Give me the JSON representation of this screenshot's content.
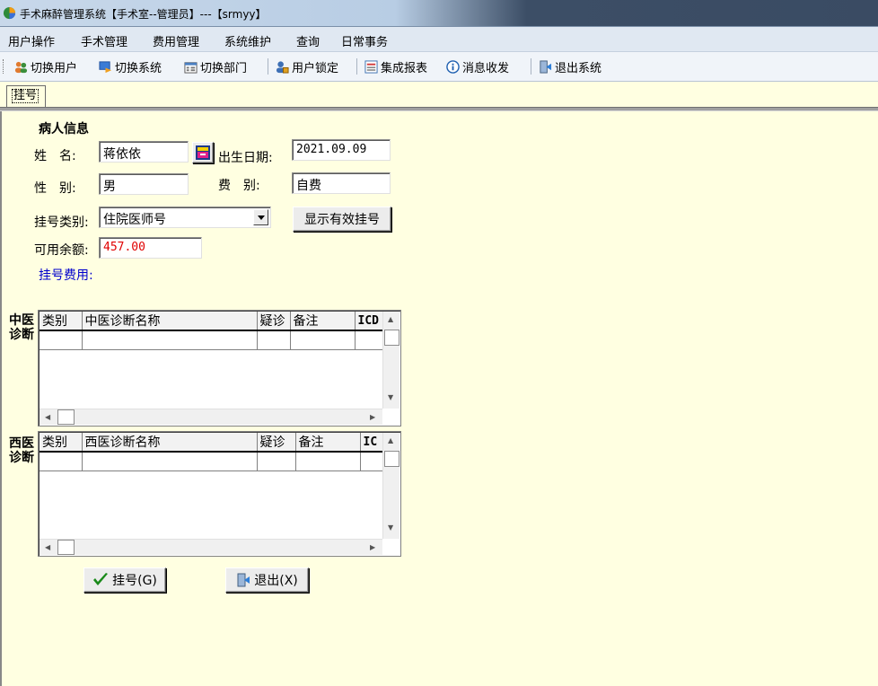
{
  "window": {
    "title": "手术麻醉管理系统【手术室--管理员】---【srmyy】"
  },
  "menu": [
    "用户操作",
    "手术管理",
    "费用管理",
    "系统维护",
    "查询",
    "日常事务"
  ],
  "toolbar": [
    {
      "label": "切换用户",
      "icon": "users-icon"
    },
    {
      "label": "切换系统",
      "icon": "switch-system-icon"
    },
    {
      "label": "切换部门",
      "icon": "department-icon"
    },
    {
      "label": "用户锁定",
      "icon": "user-lock-icon"
    },
    {
      "label": "集成报表",
      "icon": "report-icon"
    },
    {
      "label": "消息收发",
      "icon": "message-icon"
    },
    {
      "label": "退出系统",
      "icon": "exit-icon"
    }
  ],
  "tab": {
    "label": "挂号"
  },
  "patient": {
    "section_title": "病人信息",
    "name_label": "姓　名:",
    "name_value": "蒋依依",
    "birth_label": "出生日期:",
    "birth_value": "2021.09.09",
    "gender_label": "性　别:",
    "gender_value": "男",
    "fee_type_label": "费　别:",
    "fee_type_value": "自费",
    "reg_type_label": "挂号类别:",
    "reg_type_value": "住院医师号",
    "show_valid_button": "显示有效挂号",
    "balance_label": "可用余额:",
    "balance_value": "457.00",
    "reg_fee_label": "挂号费用:"
  },
  "tcm_diagnosis": {
    "title_line1": "中医",
    "title_line2": "诊断",
    "columns": [
      "类别",
      "中医诊断名称",
      "疑诊",
      "备注",
      "ICD"
    ]
  },
  "wm_diagnosis": {
    "title_line1": "西医",
    "title_line2": "诊断",
    "columns": [
      "类别",
      "西医诊断名称",
      "疑诊",
      "备注",
      "IC"
    ]
  },
  "actions": {
    "register_label": "挂号(G)",
    "exit_label": "退出(X)"
  },
  "colors": {
    "form_bg": "#ffffe1",
    "balance_text": "#e00000",
    "fee_label": "#0000cc"
  }
}
